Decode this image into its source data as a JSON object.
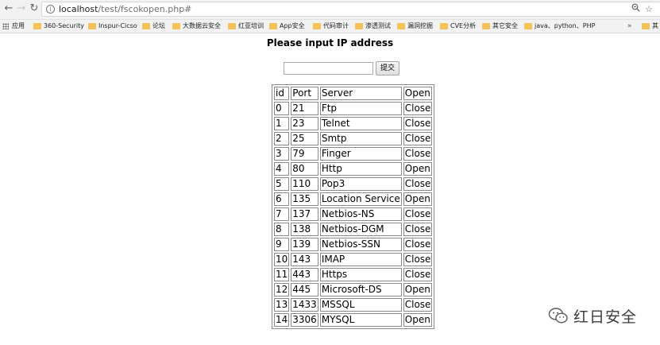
{
  "browser": {
    "url_host": "localhost",
    "url_path": "/test/fscokopen.php#",
    "bookmarks": [
      {
        "label": "应用",
        "type": "apps"
      },
      {
        "label": "360-Security"
      },
      {
        "label": "Inspur-Cicso"
      },
      {
        "label": "论坛"
      },
      {
        "label": "大数据云安全"
      },
      {
        "label": "红亚培训"
      },
      {
        "label": "App安全"
      },
      {
        "label": "代码审计"
      },
      {
        "label": "渗透测试"
      },
      {
        "label": "漏洞挖掘"
      },
      {
        "label": "CVE分析"
      },
      {
        "label": "其它安全"
      },
      {
        "label": "java、python、PHP"
      }
    ],
    "more_label": "»",
    "overflow_label": "其"
  },
  "page": {
    "heading": "Please input IP address",
    "input_value": "",
    "submit_label": "提交"
  },
  "table": {
    "headers": [
      "id",
      "Port",
      "Server",
      "Open"
    ],
    "rows": [
      [
        "0",
        "21",
        "Ftp",
        "Close"
      ],
      [
        "1",
        "23",
        "Telnet",
        "Close"
      ],
      [
        "2",
        "25",
        "Smtp",
        "Close"
      ],
      [
        "3",
        "79",
        "Finger",
        "Close"
      ],
      [
        "4",
        "80",
        "Http",
        "Open"
      ],
      [
        "5",
        "110",
        "Pop3",
        "Close"
      ],
      [
        "6",
        "135",
        "Location Service",
        "Open"
      ],
      [
        "7",
        "137",
        "Netbios-NS",
        "Close"
      ],
      [
        "8",
        "138",
        "Netbios-DGM",
        "Close"
      ],
      [
        "9",
        "139",
        "Netbios-SSN",
        "Close"
      ],
      [
        "10",
        "143",
        "IMAP",
        "Close"
      ],
      [
        "11",
        "443",
        "Https",
        "Close"
      ],
      [
        "12",
        "445",
        "Microsoft-DS",
        "Open"
      ],
      [
        "13",
        "1433",
        "MSSQL",
        "Close"
      ],
      [
        "14",
        "3306",
        "MYSQL",
        "Open"
      ]
    ]
  },
  "watermark": {
    "text": "红日安全"
  }
}
